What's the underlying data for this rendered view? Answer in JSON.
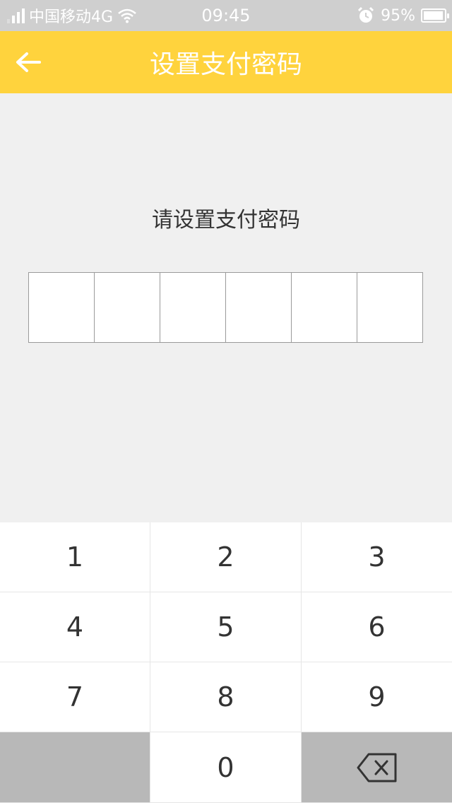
{
  "status_bar": {
    "carrier": "中国移动4G",
    "time": "09:45",
    "battery": "95%",
    "battery_level": 0.95
  },
  "header": {
    "title": "设置支付密码",
    "back_icon": "arrow-left-icon"
  },
  "prompt": "请设置支付密码",
  "password": {
    "length": 6,
    "digits": [
      "",
      "",
      "",
      "",
      "",
      ""
    ]
  },
  "keypad": {
    "keys": [
      "1",
      "2",
      "3",
      "4",
      "5",
      "6",
      "7",
      "8",
      "9",
      "",
      "0",
      ""
    ],
    "delete_icon": "backspace-icon"
  },
  "colors": {
    "accent": "#ffd33d",
    "status_bar": "#cfcfcf",
    "background": "#f0f0f0",
    "key_gray": "#b8b8b8"
  }
}
